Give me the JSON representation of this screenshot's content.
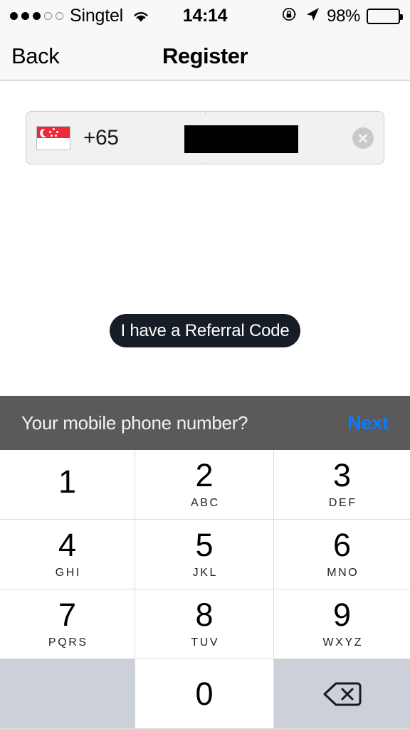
{
  "status_bar": {
    "signal_dots_filled": 3,
    "signal_dots_empty": 2,
    "carrier": "Singtel",
    "wifi_icon": "wifi-icon",
    "time": "14:14",
    "rotation_lock_icon": "rotation-lock-icon",
    "location_icon": "location-arrow-icon",
    "battery_percent": "98%",
    "battery_level": 93
  },
  "nav_bar": {
    "back_label": "Back",
    "title": "Register"
  },
  "phone_field": {
    "flag": "singapore-flag-icon",
    "country_code": "+65",
    "number_value": "",
    "number_redacted": true,
    "clear_icon": "clear-circle-icon"
  },
  "referral": {
    "label": "I have a Referral Code",
    "background_color": "#161d27",
    "text_color": "#ffffff"
  },
  "keyboard": {
    "accessory": {
      "prompt": "Your mobile phone number?",
      "next_label": "Next",
      "next_color": "#0b7bff",
      "background_color": "#5a5a5a"
    },
    "keys": [
      {
        "digit": "1",
        "letters": ""
      },
      {
        "digit": "2",
        "letters": "ABC"
      },
      {
        "digit": "3",
        "letters": "DEF"
      },
      {
        "digit": "4",
        "letters": "GHI"
      },
      {
        "digit": "5",
        "letters": "JKL"
      },
      {
        "digit": "6",
        "letters": "MNO"
      },
      {
        "digit": "7",
        "letters": "PQRS"
      },
      {
        "digit": "8",
        "letters": "TUV"
      },
      {
        "digit": "9",
        "letters": "WXYZ"
      },
      {
        "digit": "",
        "letters": ""
      },
      {
        "digit": "0",
        "letters": ""
      },
      {
        "digit": "",
        "letters": "",
        "icon": "delete-backspace-icon"
      }
    ],
    "key_background": "#ffffff",
    "special_key_background": "#ccd1d9"
  }
}
